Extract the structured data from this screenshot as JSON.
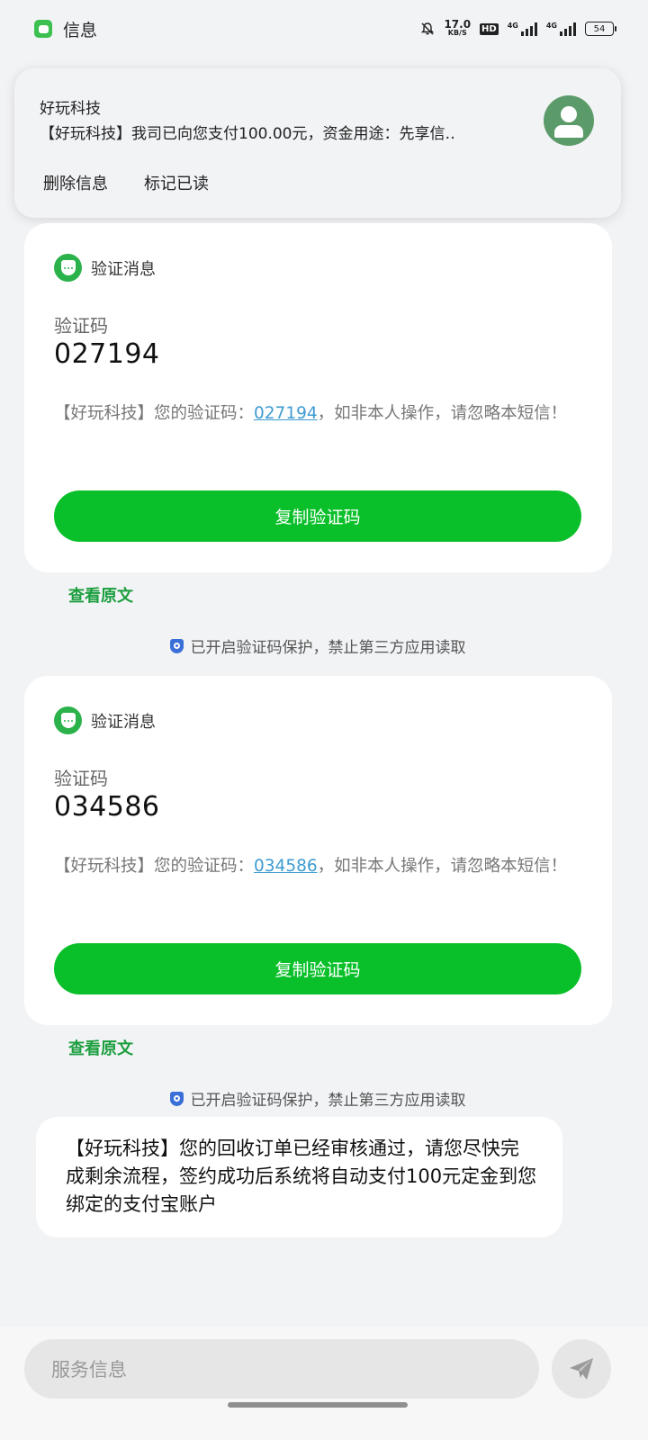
{
  "status_bar": {
    "app_name": "信息",
    "net_speed_value": "17.0",
    "net_speed_unit": "KB/S",
    "hd_label": "HD",
    "signal1_label": "4G",
    "signal2_label": "4G",
    "battery": "54",
    "icons": [
      "message-app-icon",
      "bell-muted-icon",
      "signal-icon",
      "battery-icon"
    ]
  },
  "notification": {
    "sender": "好玩科技",
    "text": "【好玩科技】我司已向您支付100.00元，资金用途：先享信‥",
    "actions": [
      "删除信息",
      "标记已读"
    ],
    "avatar_color": "#5b9b69"
  },
  "cards": [
    {
      "title": "验证消息",
      "code_label": "验证码",
      "code": "027194",
      "body_prefix": "【好玩科技】您的验证码：",
      "body_code": "027194",
      "body_suffix": "，如非本人操作，请忽略本短信！",
      "copy_label": "复制验证码",
      "view_original": "查看原文",
      "protection_notice": "已开启验证码保护，禁止第三方应用读取"
    },
    {
      "title": "验证消息",
      "code_label": "验证码",
      "code": "034586",
      "body_prefix": "【好玩科技】您的验证码：",
      "body_code": "034586",
      "body_suffix": "，如非本人操作，请忽略本短信！",
      "copy_label": "复制验证码",
      "view_original": "查看原文",
      "protection_notice": "已开启验证码保护，禁止第三方应用读取"
    }
  ],
  "message": {
    "text": "【好玩科技】您的回收订单已经审核通过，请您尽快完成剩余流程，签约成功后系统将自动支付100元定金到您绑定的支付宝账户"
  },
  "input": {
    "placeholder": "服务信息"
  },
  "colors": {
    "accent_green": "#0ac02a",
    "link_blue": "#3e9bd0",
    "view_original_green": "#1b9e3e",
    "shield_blue": "#3b6fd8"
  }
}
